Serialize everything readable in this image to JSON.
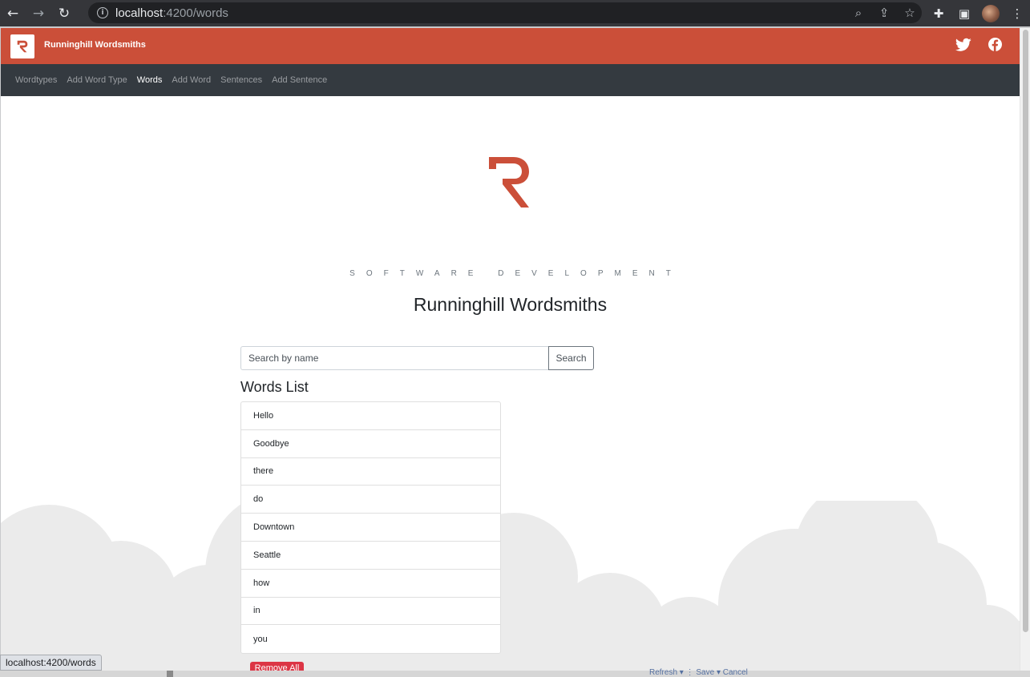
{
  "browser": {
    "back_icon": "←",
    "forward_icon": "→",
    "reload_icon": "↻",
    "url_host": "localhost",
    "url_path": ":4200/words",
    "zoom_icon": "⌕",
    "share_icon": "⇪",
    "bookmark_icon": "☆",
    "extensions_icon": "✚",
    "sidepanel_icon": "▣",
    "menu_icon": "⋮"
  },
  "topbar": {
    "brand_title": "Runninghill Wordsmiths",
    "brand_color": "#cb4f39"
  },
  "nav": {
    "items": [
      {
        "label": "Wordtypes",
        "active": false
      },
      {
        "label": "Add Word Type",
        "active": false
      },
      {
        "label": "Words",
        "active": true
      },
      {
        "label": "Add Word",
        "active": false
      },
      {
        "label": "Sentences",
        "active": false
      },
      {
        "label": "Add Sentence",
        "active": false
      }
    ]
  },
  "hero": {
    "tagline": "SOFTWARE  DEVELOPMENT",
    "title": "Runninghill Wordsmiths"
  },
  "search": {
    "placeholder": "Search by name",
    "value": "",
    "button_label": "Search"
  },
  "words": {
    "heading": "Words List",
    "items": [
      "Hello",
      "Goodbye",
      "there",
      "do",
      "Downtown",
      "Seattle",
      "how",
      "in",
      "you"
    ],
    "remove_all_label": "Remove All"
  },
  "status_bar": {
    "link_preview": "localhost:4200/words"
  },
  "background_window": {
    "toolbar_text": "Refresh ▾ ⋮ Save ▾ Cancel"
  }
}
